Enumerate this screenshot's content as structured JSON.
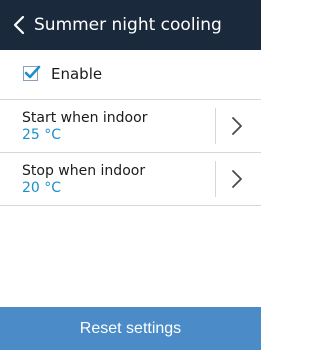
{
  "header": {
    "title": "Summer night cooling",
    "back_icon": "chevron-left-icon"
  },
  "enable": {
    "label": "Enable",
    "checked": true
  },
  "settings": [
    {
      "label": "Start when indoor",
      "value": "25 °C",
      "icon": "chevron-right-icon"
    },
    {
      "label": "Stop when indoor",
      "value": "20 °C",
      "icon": "chevron-right-icon"
    }
  ],
  "footer": {
    "reset_label": "Reset settings"
  },
  "colors": {
    "header_bg": "#1a2a3c",
    "accent": "#1d8fcc",
    "button_bg": "#4a8bc8",
    "divider": "#d7d7d7"
  }
}
